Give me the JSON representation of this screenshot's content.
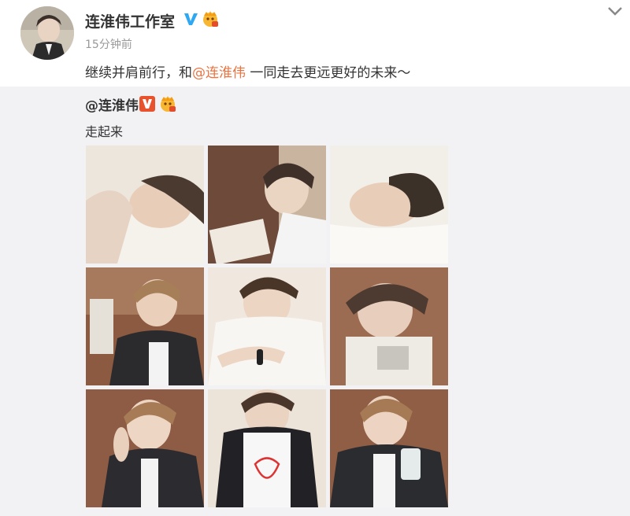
{
  "post": {
    "author": "连淮伟工作室",
    "verified_icon": "verified-v-icon",
    "level_icon": "member-level-icon",
    "timestamp": "15分钟前",
    "text_before": "继续并肩前行，和",
    "mention": "@连淮伟",
    "text_after": " 一同走去更远更好的未来～",
    "colors": {
      "mention": "#eb7340",
      "verified": "#2fa8f4",
      "background": "#f2f2f5"
    }
  },
  "repost": {
    "author": "@连淮伟",
    "verified_icon": "verified-red-v-icon",
    "level_icon": "member-level-icon",
    "text": "走起来",
    "photos": [
      {
        "name": "photo-1"
      },
      {
        "name": "photo-2"
      },
      {
        "name": "photo-3"
      },
      {
        "name": "photo-4"
      },
      {
        "name": "photo-5"
      },
      {
        "name": "photo-6"
      },
      {
        "name": "photo-7"
      },
      {
        "name": "photo-8"
      },
      {
        "name": "photo-9"
      }
    ]
  }
}
